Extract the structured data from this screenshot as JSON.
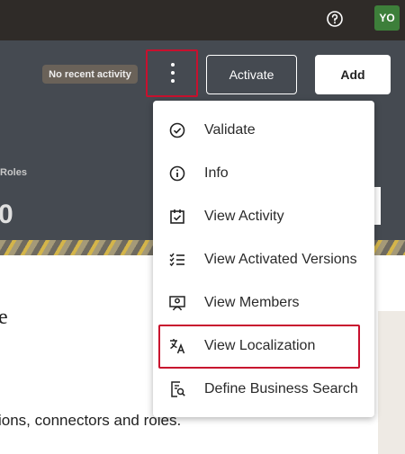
{
  "topbar": {
    "help_icon": "help-circle-icon",
    "avatar_initials": "YO",
    "avatar_color": "#3d7f3a"
  },
  "header": {
    "status_badge": "No recent activity",
    "activate_label": "Activate",
    "add_label": "Add",
    "roles_label": "Roles",
    "big_value": "0"
  },
  "content": {
    "partial_heading": "e",
    "partial_desc": "ions, connectors and roles."
  },
  "menu": {
    "items": [
      {
        "label": "Validate",
        "icon": "check-circle-icon"
      },
      {
        "label": "Info",
        "icon": "info-icon"
      },
      {
        "label": "View Activity",
        "icon": "calendar-check-icon"
      },
      {
        "label": "View Activated Versions",
        "icon": "checklist-icon"
      },
      {
        "label": "View Members",
        "icon": "members-icon"
      },
      {
        "label": "View Localization",
        "icon": "translate-icon"
      },
      {
        "label": "Define Business Search",
        "icon": "search-document-icon"
      }
    ]
  },
  "colors": {
    "highlight": "#c8102e",
    "header_bg": "#454a51",
    "topbar_bg": "#2f2b28"
  }
}
